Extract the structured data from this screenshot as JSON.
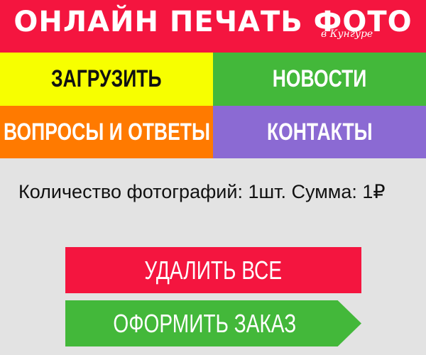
{
  "header": {
    "logo_main": "ОНЛАЙН ПЕЧАТЬ ФОТО",
    "logo_sub": "в Кунгуре"
  },
  "nav": {
    "upload": "ЗАГРУЗИТЬ",
    "news": "НОВОСТИ",
    "faq": "ВОПРОСЫ И ОТВЕТЫ",
    "contacts": "КОНТАКТЫ"
  },
  "summary": {
    "text": "Количество фотографий: 1шт. Сумма: 1₽"
  },
  "actions": {
    "delete_all": "УДАЛИТЬ ВСЕ",
    "checkout": "ОФОРМИТЬ ЗАКАЗ"
  },
  "colors": {
    "red": "#f4153f",
    "yellow": "#f7ff00",
    "green": "#43b83a",
    "orange": "#ff7a00",
    "purple": "#8b6ad3",
    "background": "#e3e3e3"
  }
}
